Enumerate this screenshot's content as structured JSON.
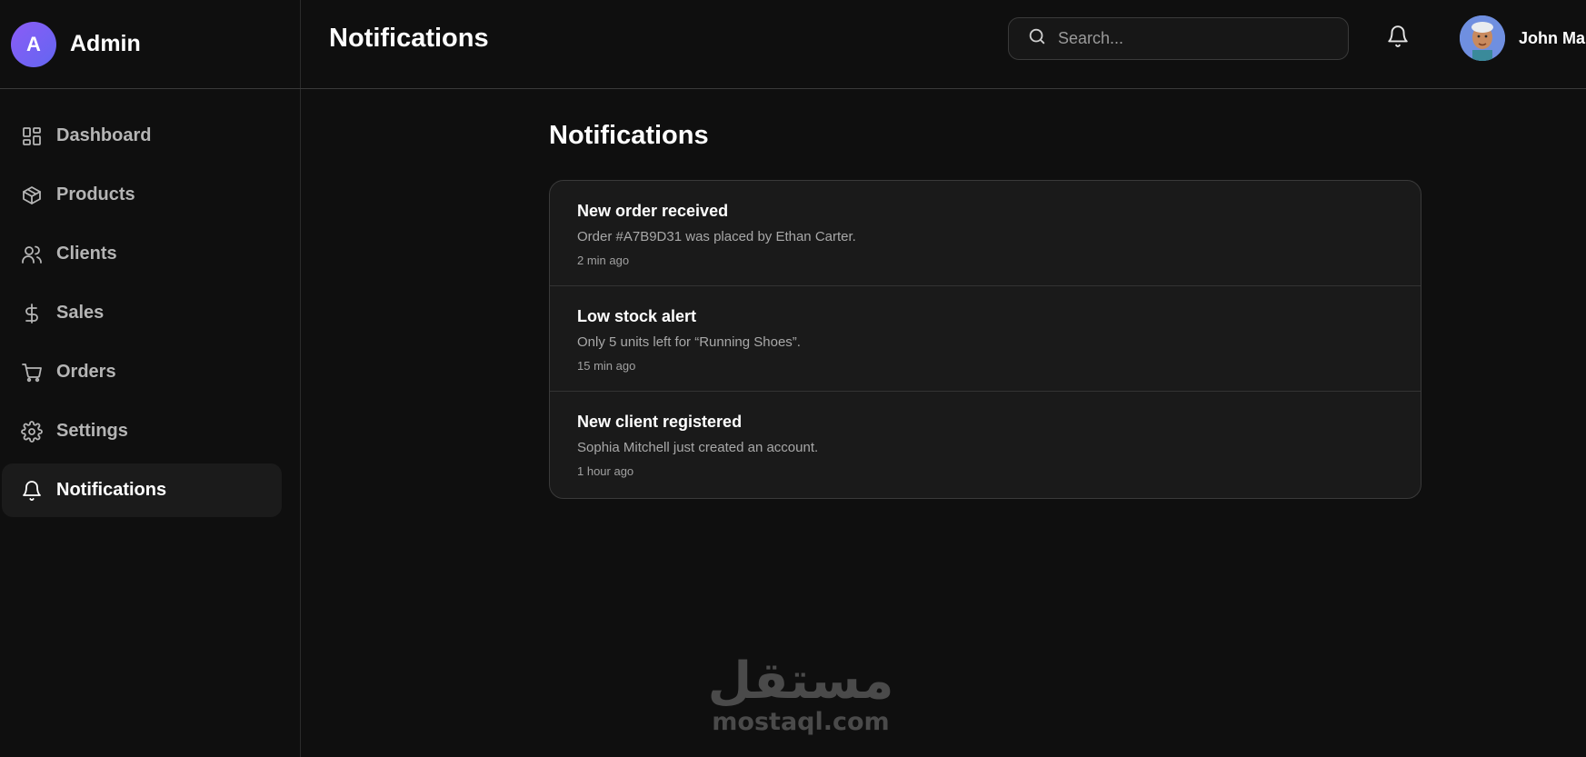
{
  "brand": {
    "avatar_letter": "A",
    "name": "Admin"
  },
  "sidebar": {
    "items": [
      {
        "label": "Dashboard",
        "icon": "dashboard-grid-icon"
      },
      {
        "label": "Products",
        "icon": "box-icon"
      },
      {
        "label": "Clients",
        "icon": "users-icon"
      },
      {
        "label": "Sales",
        "icon": "dollar-icon"
      },
      {
        "label": "Orders",
        "icon": "cart-icon"
      },
      {
        "label": "Settings",
        "icon": "gear-icon"
      },
      {
        "label": "Notifications",
        "icon": "bell-icon",
        "active": true
      }
    ]
  },
  "header": {
    "title": "Notifications",
    "search_placeholder": "Search...",
    "user_name": "John Mar"
  },
  "main": {
    "title": "Notifications",
    "notifications": [
      {
        "title": "New order received",
        "body": "Order #A7B9D31 was placed by Ethan Carter.",
        "time": "2 min ago"
      },
      {
        "title": "Low stock alert",
        "body": "Only 5 units left for “Running Shoes”.",
        "time": "15 min ago"
      },
      {
        "title": "New client registered",
        "body": "Sophia Mitchell just created an account.",
        "time": "1 hour ago"
      }
    ]
  },
  "watermark": {
    "arabic": "مستقل",
    "latin": "mostaql.com"
  },
  "colors": {
    "background": "#0f0f0f",
    "card": "#1a1a1a",
    "accent": "#8b5cf6",
    "border": "#3a3a3a"
  }
}
